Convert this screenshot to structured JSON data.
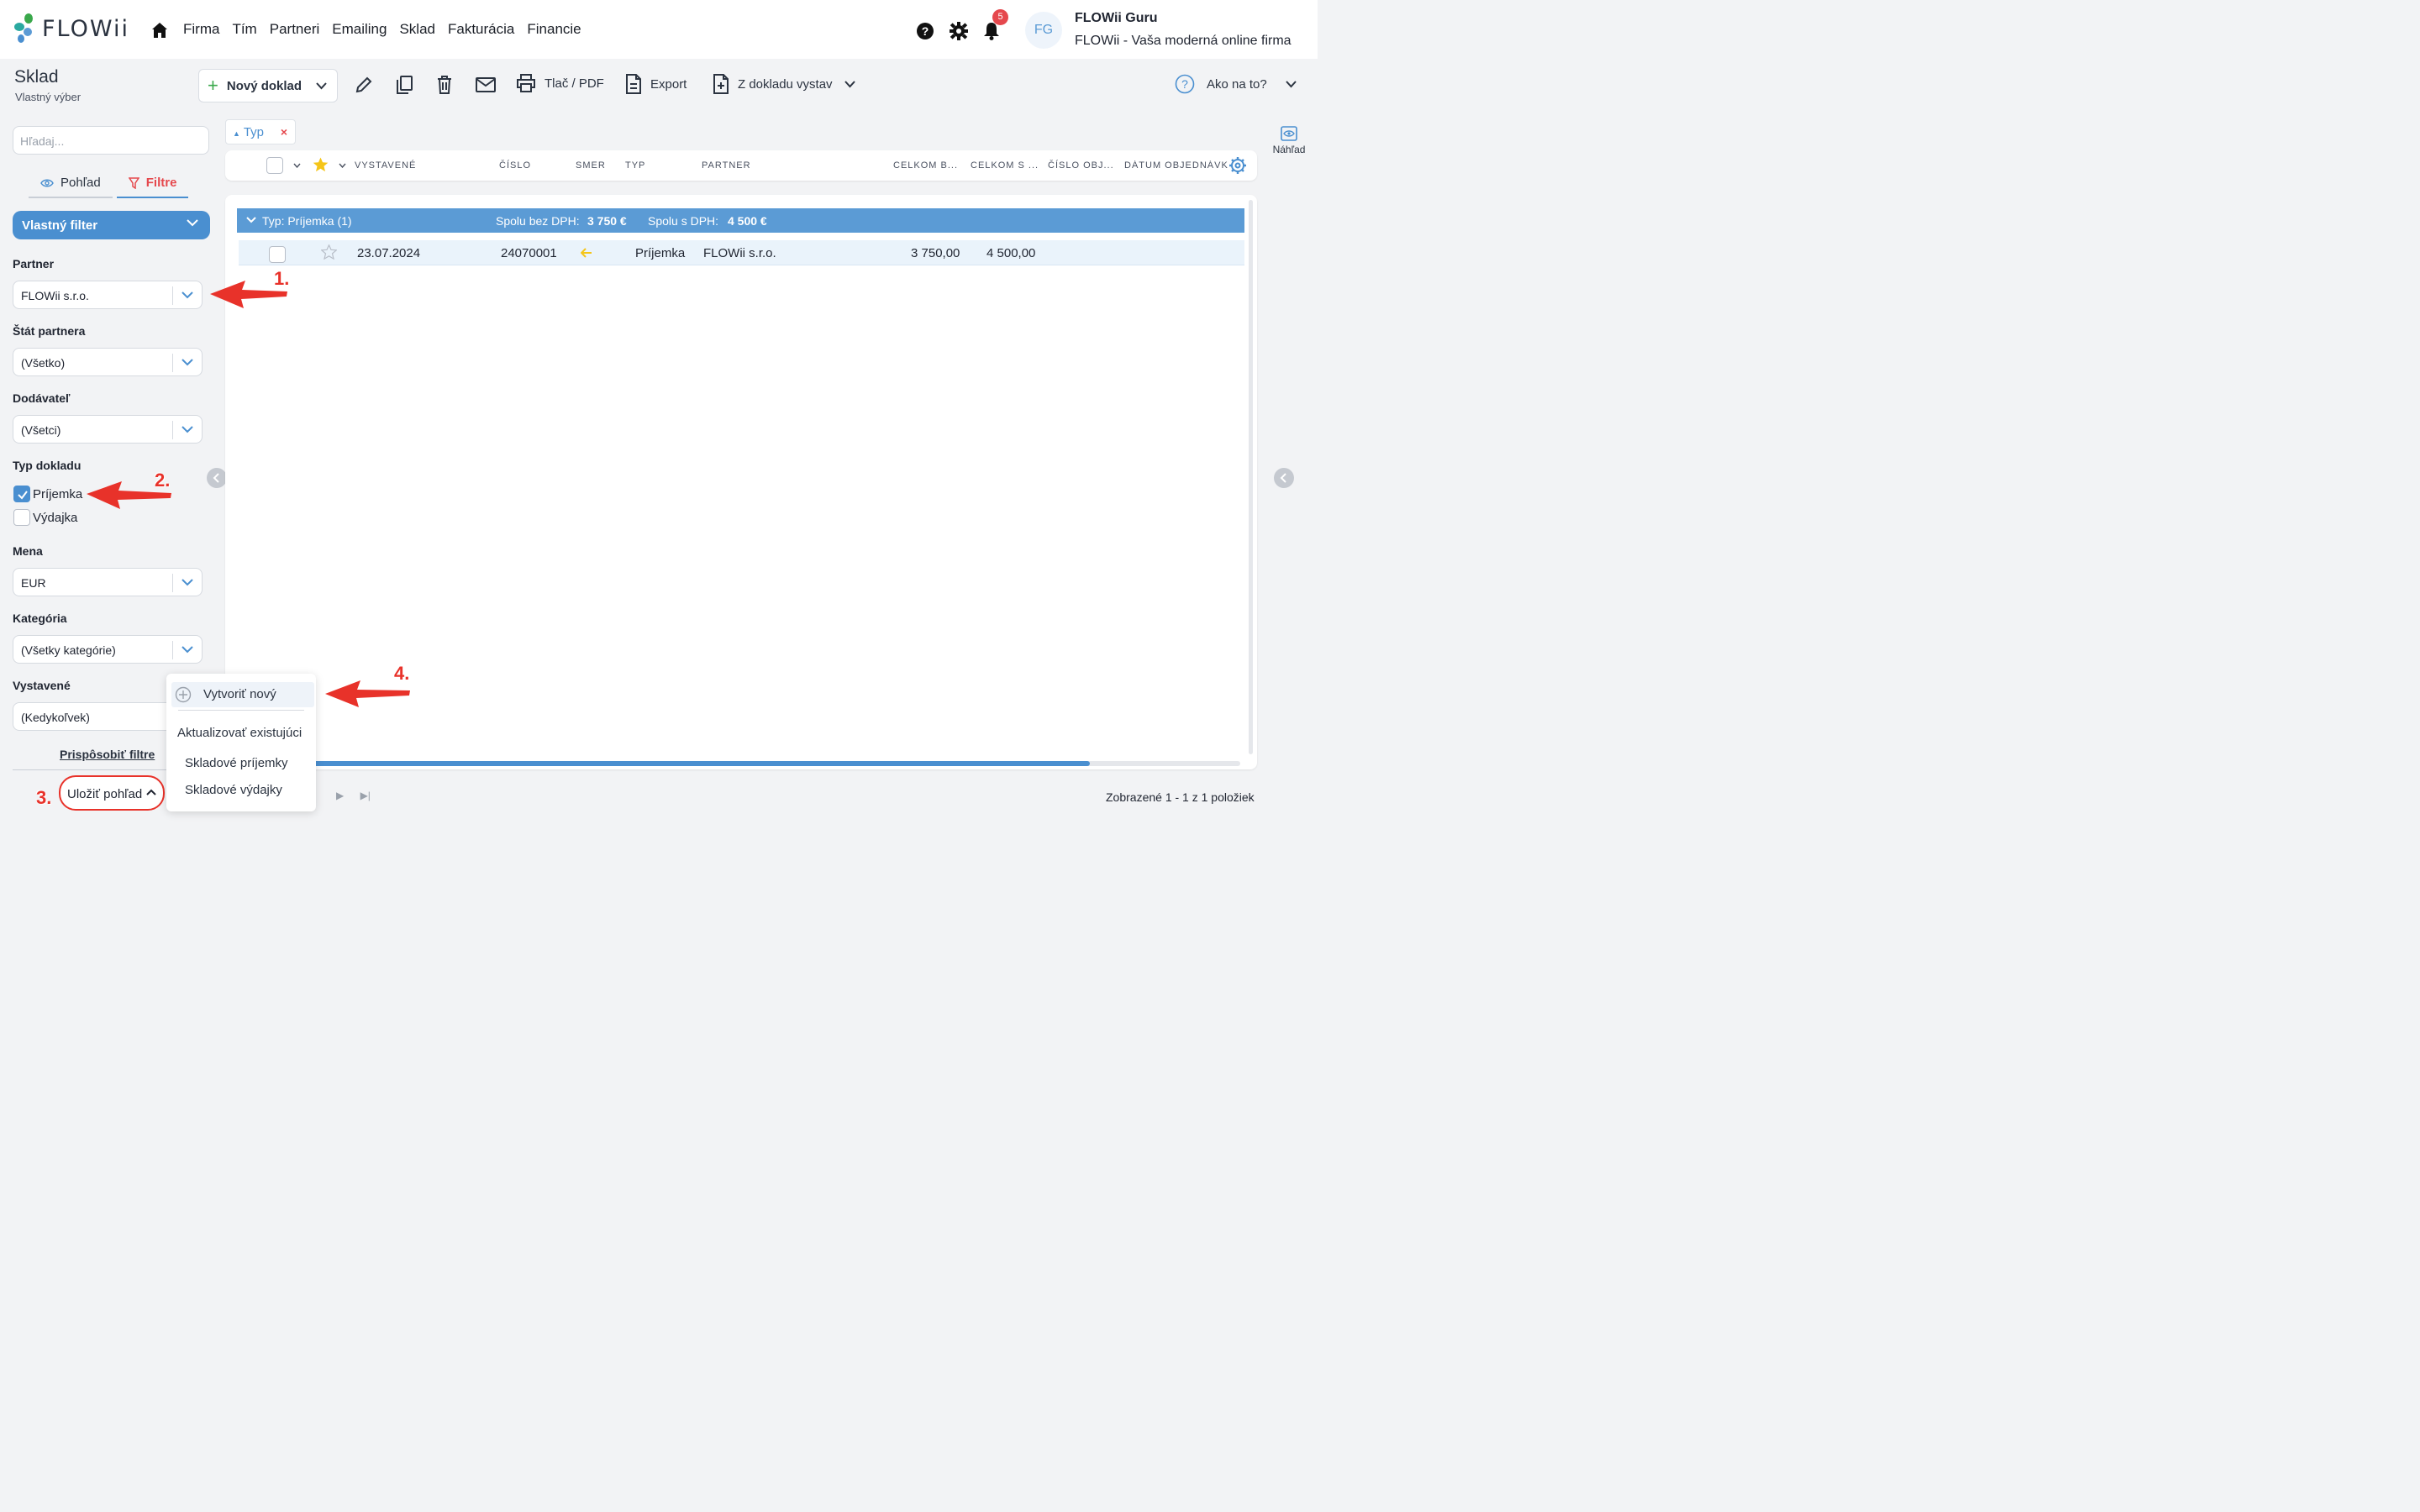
{
  "app": {
    "logo_text": "FLOWii",
    "nav": [
      "Firma",
      "Tím",
      "Partneri",
      "Emailing",
      "Sklad",
      "Fakturácia",
      "Financie"
    ],
    "notifications_count": "5",
    "avatar_initials": "FG",
    "user_name": "FLOWii Guru",
    "user_company": "FLOWii - Vaša moderná online firma"
  },
  "module": {
    "title": "Sklad",
    "subtitle": "Vlastný výber"
  },
  "toolbar": {
    "new_doc": "Nový doklad",
    "print": "Tlač / PDF",
    "export": "Export",
    "from_doc": "Z dokladu vystav",
    "help": "Ako na to?"
  },
  "sidebar": {
    "search_placeholder": "Hľadaj...",
    "tab_view": "Pohľad",
    "tab_filters": "Filtre",
    "custom_filter": "Vlastný filter",
    "filters": [
      {
        "label": "Partner",
        "value": "FLOWii s.r.o."
      },
      {
        "label": "Štát partnera",
        "value": "(Všetko)"
      },
      {
        "label": "Dodávateľ",
        "value": "(Všetci)"
      },
      {
        "label": "Mena",
        "value": "EUR"
      },
      {
        "label": "Kategória",
        "value": "(Všetky kategórie)"
      },
      {
        "label": "Vystavené",
        "value": "(Kedykoľvek)"
      }
    ],
    "doc_type_label": "Typ dokladu",
    "doc_types": [
      {
        "label": "Príjemka",
        "checked": true
      },
      {
        "label": "Výdajka",
        "checked": false
      }
    ],
    "customize": "Prispôsobiť filtre",
    "save_view": "Uložiť pohľad"
  },
  "grid": {
    "group_chip": "Typ",
    "columns": [
      "VYSTAVENÉ",
      "ČÍSLO",
      "SMER",
      "TYP",
      "PARTNER",
      "CELKOM B...",
      "CELKOM S ...",
      "ČÍSLO OBJ...",
      "DÁTUM OBJEDNÁVK"
    ],
    "group": {
      "label": "Typ: Príjemka (1)",
      "sum_net_label": "Spolu bez DPH:",
      "sum_net": "3 750 €",
      "sum_gross_label": "Spolu s DPH:",
      "sum_gross": "4 500 €"
    },
    "rows": [
      {
        "date": "23.07.2024",
        "number": "24070001",
        "type": "Príjemka",
        "partner": "FLOWii s.r.o.",
        "total_net": "3 750,00",
        "total_gross": "4 500,00"
      }
    ],
    "shown": "Zobrazené 1 - 1 z 1 položiek"
  },
  "preview_label": "Náhľad",
  "menu": {
    "create_new": "Vytvoriť nový",
    "update_existing": "Aktualizovať existujúci",
    "views": [
      "Skladové príjemky",
      "Skladové výdajky"
    ]
  },
  "annotations": [
    "1.",
    "2.",
    "3.",
    "4."
  ],
  "colors": {
    "accent": "#4a8fd0",
    "group_bar": "#5b9bd5",
    "alert": "#e8322a",
    "brand_green": "#3aa84b"
  }
}
